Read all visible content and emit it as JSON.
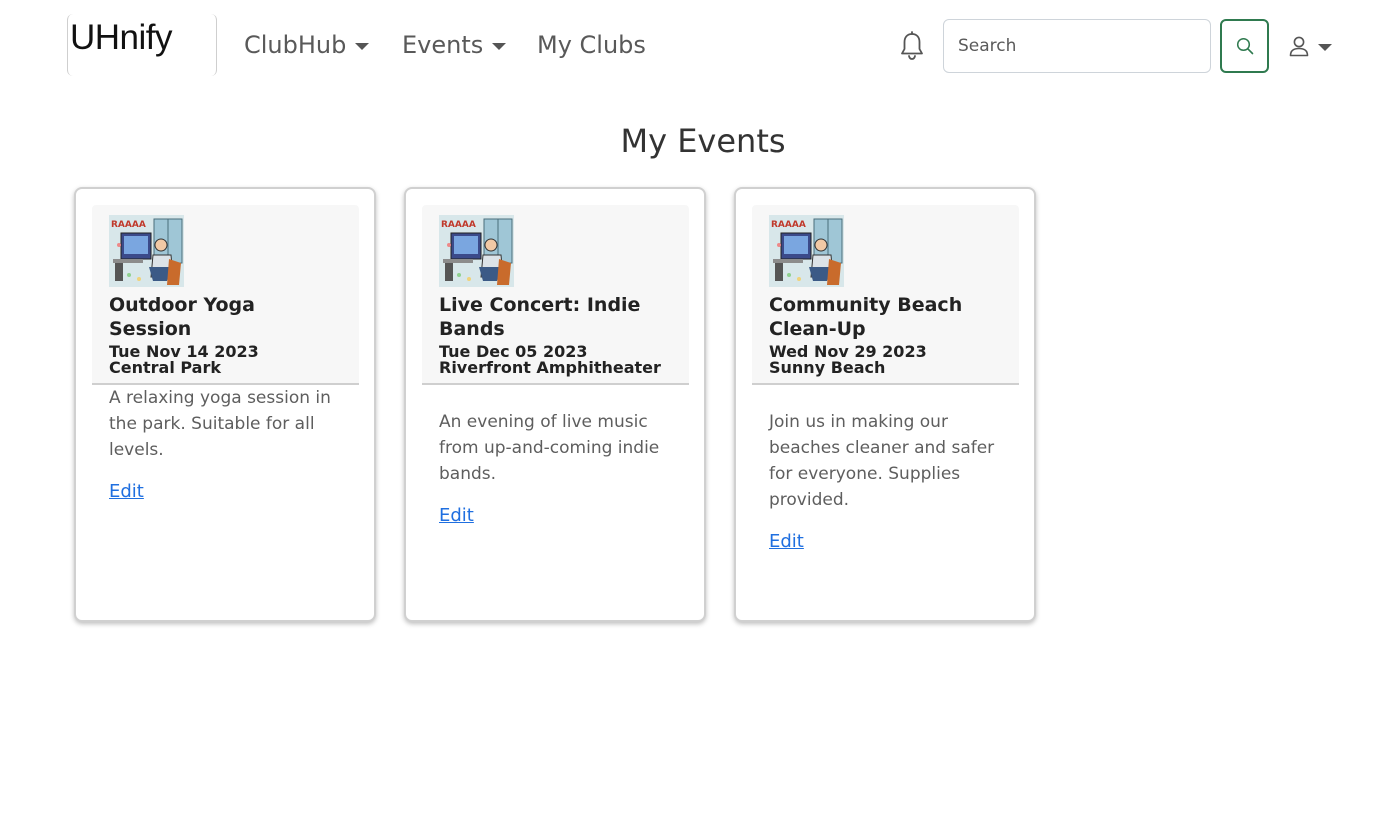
{
  "navbar": {
    "brand": "UHnify",
    "menu": [
      {
        "label": "ClubHub",
        "dropdown": true
      },
      {
        "label": "Events",
        "dropdown": true
      },
      {
        "label": "My Clubs",
        "dropdown": false
      }
    ],
    "search": {
      "placeholder": "Search",
      "value": ""
    },
    "icons": {
      "notifications": "bell-icon",
      "search": "search-icon",
      "user": "user-icon"
    },
    "colors": {
      "search_button_border": "#2f7a4f",
      "link": "#1f6fe0"
    }
  },
  "page": {
    "title": "My Events"
  },
  "events": [
    {
      "title": "Outdoor Yoga Session",
      "date": "Tue Nov 14 2023",
      "location": "Central Park",
      "description": "A relaxing yoga session in the park. Suitable for all levels.",
      "edit_label": "Edit"
    },
    {
      "title": "Live Concert: Indie Bands",
      "date": "Tue Dec 05 2023",
      "location": "Riverfront Amphitheater",
      "description": "An evening of live music from up-and-coming indie bands.",
      "edit_label": "Edit"
    },
    {
      "title": "Community Beach Clean-Up",
      "date": "Wed Nov 29 2023",
      "location": "Sunny Beach",
      "description": "Join us in making our beaches cleaner and safer for everyone. Supplies provided.",
      "edit_label": "Edit"
    }
  ]
}
